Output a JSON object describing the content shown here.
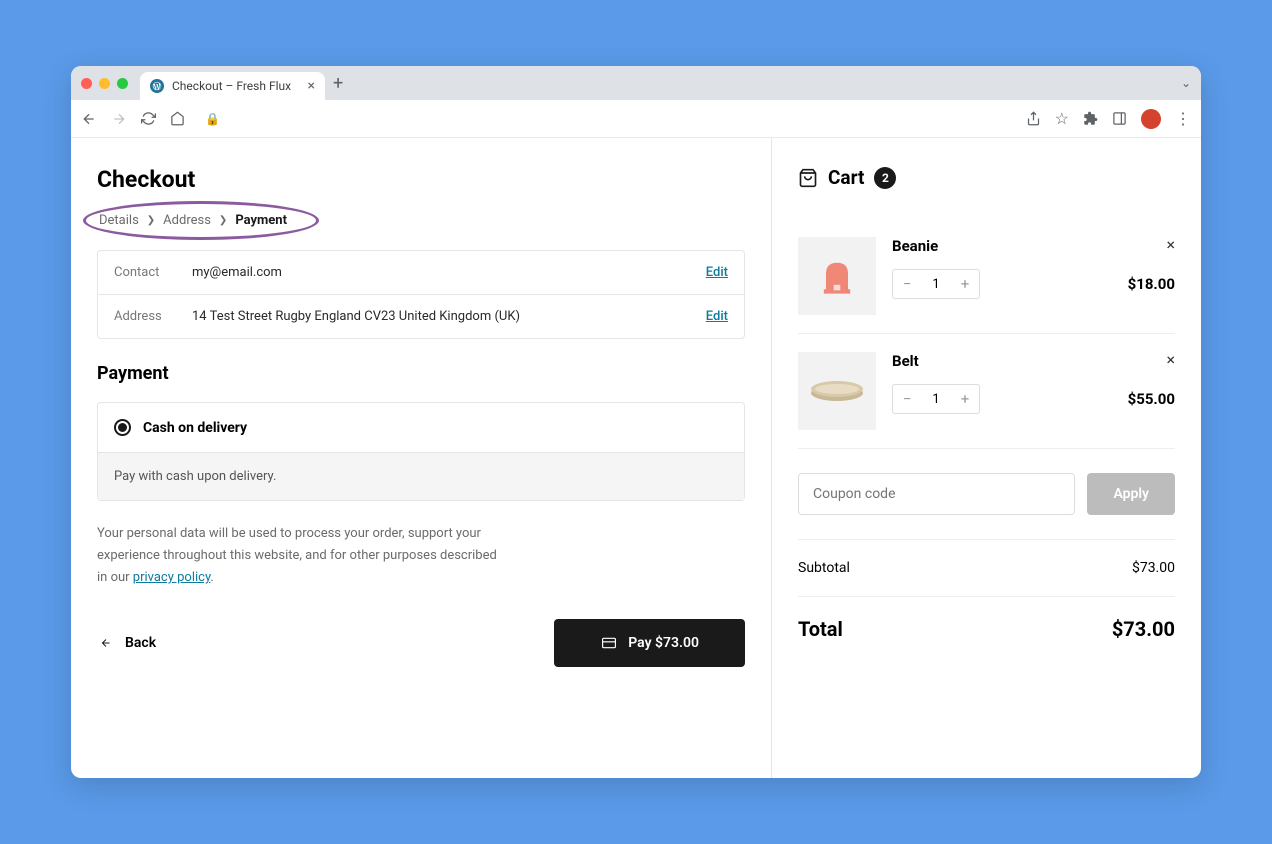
{
  "browser": {
    "tab_title": "Checkout – Fresh Flux"
  },
  "checkout": {
    "title": "Checkout",
    "breadcrumb": {
      "step1": "Details",
      "step2": "Address",
      "step3": "Payment"
    },
    "details": {
      "contact_label": "Contact",
      "contact_value": "my@email.com",
      "address_label": "Address",
      "address_value": "14 Test Street Rugby England CV23 United Kingdom (UK)",
      "edit_label": "Edit"
    },
    "payment_heading": "Payment",
    "payment_option": {
      "label": "Cash on delivery",
      "description": "Pay with cash upon delivery."
    },
    "privacy_text_1": "Your personal data will be used to process your order, support your experience throughout this website, and for other purposes described in our ",
    "privacy_link": "privacy policy",
    "privacy_text_2": ".",
    "back_label": "Back",
    "pay_label": "Pay $73.00"
  },
  "cart": {
    "heading": "Cart",
    "count": "2",
    "items": [
      {
        "name": "Beanie",
        "qty": "1",
        "price": "$18.00"
      },
      {
        "name": "Belt",
        "qty": "1",
        "price": "$55.00"
      }
    ],
    "coupon_placeholder": "Coupon code",
    "apply_label": "Apply",
    "subtotal_label": "Subtotal",
    "subtotal_value": "$73.00",
    "total_label": "Total",
    "total_value": "$73.00"
  }
}
